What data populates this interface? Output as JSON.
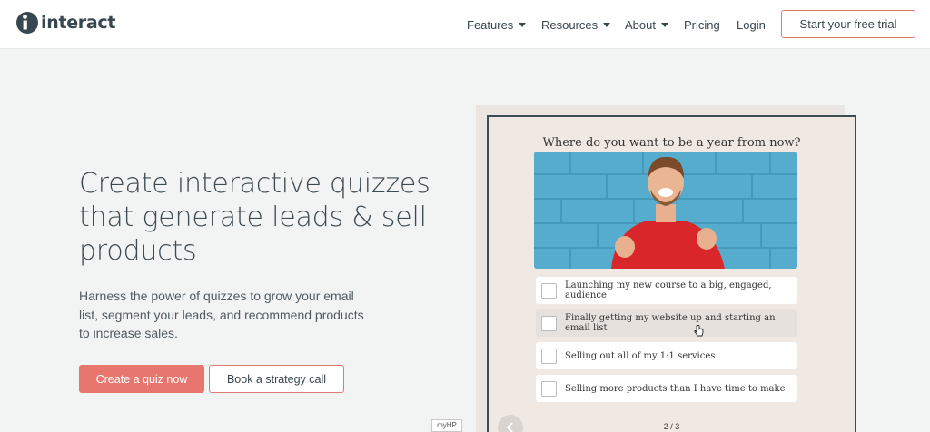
{
  "header": {
    "logo_text": "interact",
    "nav": [
      {
        "label": "Features",
        "has_dropdown": true
      },
      {
        "label": "Resources",
        "has_dropdown": true
      },
      {
        "label": "About",
        "has_dropdown": true
      },
      {
        "label": "Pricing",
        "has_dropdown": false
      },
      {
        "label": "Login",
        "has_dropdown": false
      }
    ],
    "cta_label": "Start your free trial"
  },
  "hero": {
    "headline": "Create interactive quizzes that generate leads & sell products",
    "subtext": "Harness the power of quizzes to grow your email list, segment your leads, and recommend products to increase sales.",
    "primary_button": "Create a quiz now",
    "secondary_button": "Book a strategy call"
  },
  "quiz": {
    "question": "Where do you want to be a year from now?",
    "options": [
      "Launching my new course to a big, engaged, audience",
      "Finally getting my website up and starting an email list",
      "Selling out all of my 1:1 services",
      "Selling more products than I have time to make"
    ],
    "pager": "2 / 3"
  },
  "badge": "myHP",
  "colors": {
    "accent": "#e7766f",
    "text": "#37474f",
    "background": "#f2f4f3"
  },
  "icons": {
    "logo": "interact-logo-mark",
    "dropdown": "caret-down-icon",
    "prev": "chevron-left-icon",
    "cursor": "hand-pointer-icon"
  }
}
